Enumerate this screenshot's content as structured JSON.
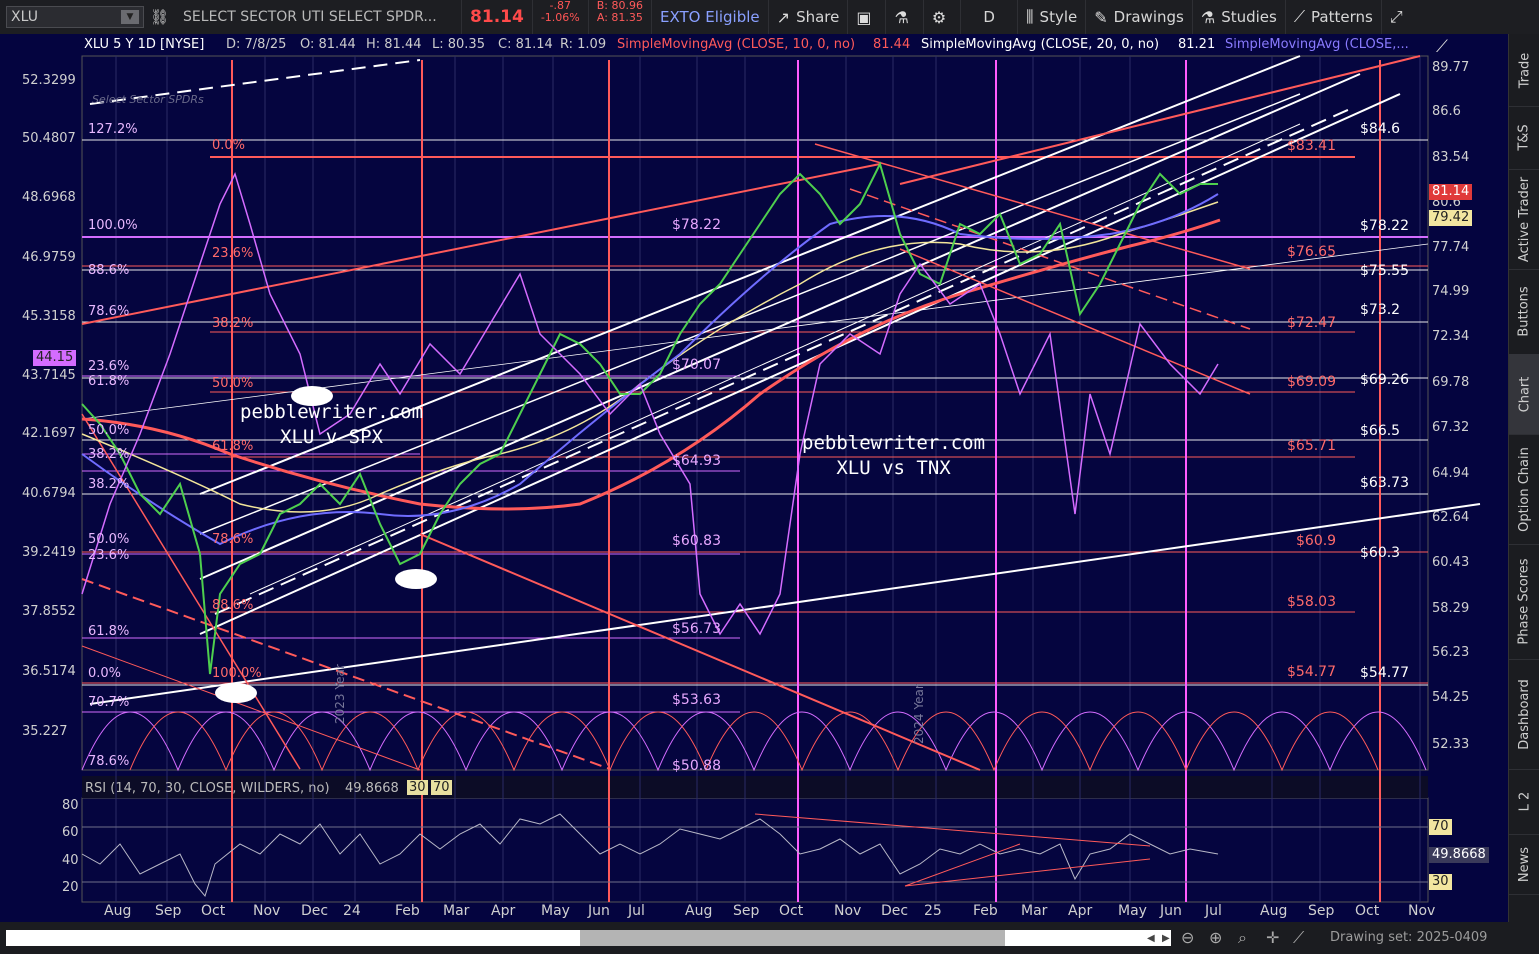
{
  "topbar": {
    "symbol": "XLU",
    "description": "SELECT SECTOR UTI SELECT SPDR...",
    "last": "81.14",
    "change": "-.87",
    "change_pct": "-1.06%",
    "bid": "B: 80.96",
    "ask": "A: 81.35",
    "exto": "EXTO Eligible",
    "share": "Share",
    "timeframe": "D",
    "style": "Style",
    "drawings": "Drawings",
    "studies": "Studies",
    "patterns": "Patterns"
  },
  "header": {
    "title": "XLU 5 Y 1D [NYSE]",
    "date": "D: 7/8/25",
    "open": "O: 81.44",
    "high": "H: 81.44",
    "low": "L: 80.35",
    "close": "C: 81.14",
    "range": "R: 1.09",
    "sma10": "SimpleMovingAvg (CLOSE, 10, 0, no)",
    "sma10_val": "81.44",
    "sma20": "SimpleMovingAvg (CLOSE, 20, 0, no)",
    "sma20_val": "81.21",
    "sma_more": "SimpleMovingAvg (CLOSE,..."
  },
  "y_axis": [
    "89.77",
    "86.6",
    "83.54",
    "80.6",
    "77.74",
    "74.99",
    "72.34",
    "69.78",
    "67.32",
    "64.94",
    "62.64",
    "60.43",
    "58.29",
    "56.23",
    "54.25",
    "52.33"
  ],
  "left_axis": [
    "52.3299",
    "50.4807",
    "48.6968",
    "46.9759",
    "45.3158",
    "43.7145",
    "42.1697",
    "40.6794",
    "39.2419",
    "37.8552",
    "36.5174",
    "35.227"
  ],
  "price_tags": {
    "last": "81.14",
    "sma": "79.42",
    "left": "44.15",
    "rsi_val": "49.8668",
    "rsi_hi": "70",
    "rsi_lo": "30"
  },
  "white_levels": [
    "$84.6",
    "$78.22",
    "$75.55",
    "$73.2",
    "$69.26",
    "$66.5",
    "$63.73",
    "$60.3",
    "$54.77"
  ],
  "red_levels": [
    "$83.41",
    "$76.65",
    "$72.47",
    "$69.09",
    "$65.71",
    "$60.9",
    "$58.03",
    "$54.77"
  ],
  "pink_levels": [
    "$78.22",
    "$70.07",
    "$64.93",
    "$60.83",
    "$56.73",
    "$53.63",
    "$50.88"
  ],
  "fib_labels": [
    "127.2%",
    "0.0%",
    "100.0%",
    "23.6%",
    "88.6%",
    "78.6%",
    "38.2%",
    "23.6%",
    "61.8%",
    "50.0%",
    "50.0%",
    "61.8%",
    "38.2%",
    "38.2%",
    "78.6%",
    "50.0%",
    "23.6%",
    "88.6%",
    "61.8%",
    "0.0%",
    "100.0%",
    "70.7%",
    "78.6%"
  ],
  "watermarks": [
    {
      "line1": "pebblewriter.com",
      "line2": "XLU v SPX"
    },
    {
      "line1": "pebblewriter.com",
      "line2": "XLU vs TNX"
    }
  ],
  "logo_text": "Select Sector SPDRs",
  "year_labels": [
    "2023 Year",
    "2024 Year"
  ],
  "rsi": {
    "label": "RSI (14, 70, 30, CLOSE, WILDERS, no)",
    "value": "49.8668",
    "ob": "30",
    "os": "70",
    "ticks": [
      "80",
      "60",
      "40",
      "20"
    ]
  },
  "x_axis": [
    "Aug",
    "Sep",
    "Oct",
    "Nov",
    "Dec",
    "24",
    "Feb",
    "Mar",
    "Apr",
    "May",
    "Jun",
    "Jul",
    "Aug",
    "Sep",
    "Oct",
    "Nov",
    "Dec",
    "25",
    "Feb",
    "Mar",
    "Apr",
    "May",
    "Jun",
    "Jul",
    "Aug",
    "Sep",
    "Oct",
    "Nov"
  ],
  "right_tabs": [
    "Trade",
    "T&S",
    "Active Trader",
    "Buttons",
    "Chart",
    "Option Chain",
    "Phase Scores",
    "Dashboard",
    "L 2",
    "News"
  ],
  "drawing_set": "Drawing set: 2025-0409",
  "colors": {
    "bg": "#04043f",
    "white_line": "#ffffff",
    "red_line": "#ff5a5a",
    "pink_line": "#d86cff",
    "magenta_vline": "#ff5cff"
  }
}
